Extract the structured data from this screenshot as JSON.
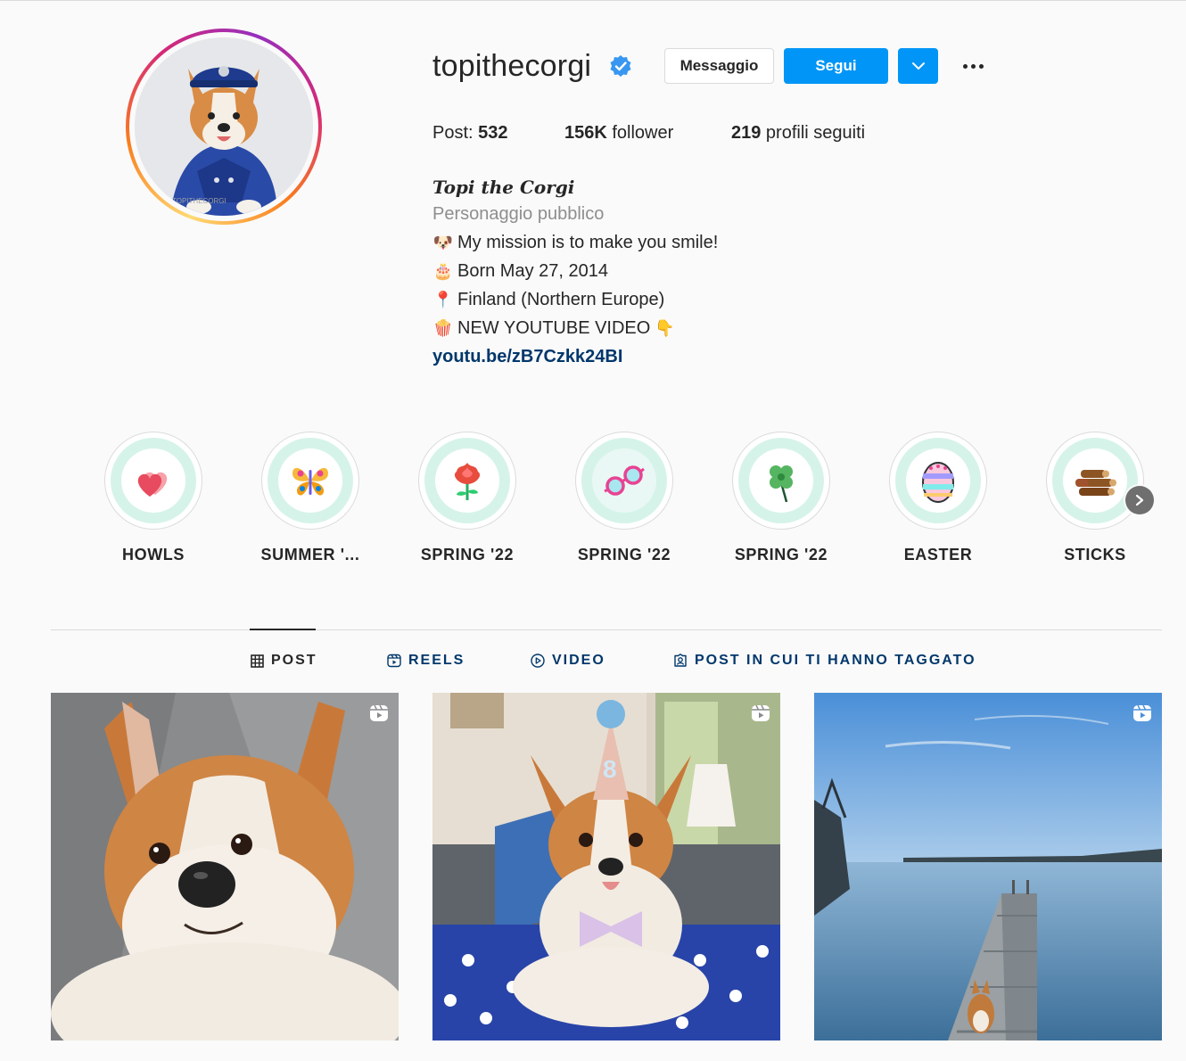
{
  "profile": {
    "username": "topithecorgi",
    "verified": true,
    "avatar_watermark": "TOPITHECORGI",
    "buttons": {
      "message": "Messaggio",
      "follow": "Segui"
    },
    "stats": {
      "posts_label": "Post: ",
      "posts_value": "532",
      "followers_value": "156K",
      "followers_label": " follower",
      "following_value": "219",
      "following_label": " profili seguiti"
    },
    "full_name": "Topi the Corgi",
    "category": "Personaggio pubblico",
    "bio_lines": [
      {
        "emoji": "🐶",
        "text": "My mission is to make you smile!"
      },
      {
        "emoji": "🎂",
        "text": "Born May 27, 2014"
      },
      {
        "emoji": "📍",
        "text": "Finland (Northern Europe)"
      },
      {
        "emoji": "🍿",
        "text": "NEW YOUTUBE VIDEO",
        "trailing_emoji": "👇"
      }
    ],
    "link": "youtu.be/zB7Czkk24BI"
  },
  "highlights": [
    {
      "label": "HOWLS",
      "icon": "hearts-icon"
    },
    {
      "label": "SUMMER '...",
      "icon": "butterfly-icon"
    },
    {
      "label": "SPRING '22",
      "icon": "flower-icon"
    },
    {
      "label": "SPRING '22",
      "icon": "sunglasses-icon"
    },
    {
      "label": "SPRING '22",
      "icon": "clover-icon"
    },
    {
      "label": "EASTER",
      "icon": "easter-egg-icon"
    },
    {
      "label": "STICKS",
      "icon": "logs-icon"
    }
  ],
  "tabs": [
    {
      "label": "POST",
      "icon": "grid-icon",
      "active": true
    },
    {
      "label": "REELS",
      "icon": "reels-icon",
      "active": false
    },
    {
      "label": "VIDEO",
      "icon": "play-icon",
      "active": false
    },
    {
      "label": "POST IN CUI TI HANNO TAGGATO",
      "icon": "tagged-icon",
      "active": false
    }
  ],
  "posts": [
    {
      "type": "reel",
      "subject": "corgi-closeup"
    },
    {
      "type": "reel",
      "subject": "corgi-birthday-hat"
    },
    {
      "type": "reel",
      "subject": "corgi-on-pier"
    }
  ],
  "colors": {
    "accent": "#0095f6",
    "link": "#00376b",
    "highlight_ring": "#d6f3ea",
    "text": "#262626",
    "muted": "#8e8e8e"
  }
}
